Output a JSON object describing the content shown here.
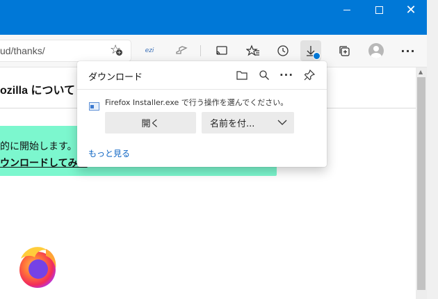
{
  "window": {
    "minimize_glyph": "",
    "close_glyph": "✕"
  },
  "toolbar": {
    "url": "ud/thanks/",
    "ext1_label": "ezi",
    "more_glyph": "···"
  },
  "icons": {
    "favorite_add": "add-favorite-icon",
    "cast": "cast-icon",
    "favorites": "favorites-icon",
    "history": "history-icon",
    "download": "download-icon",
    "collections": "collections-icon",
    "profile": "profile-icon"
  },
  "page": {
    "title": "ozilla について",
    "notice_line1": "的に開始します。",
    "notice_line2": "ウンロードしてみて"
  },
  "downloads": {
    "title": "ダウンロード",
    "message": "Firefox Installer.exe で行う操作を選んでください。",
    "open_label": "開く",
    "saveas_label": "名前を付...",
    "more_link": "もっと見る",
    "more_glyph": "···"
  },
  "colors": {
    "titlebar": "#0078d7",
    "notice_bg": "#7cf7ce",
    "link": "#0b63c3"
  }
}
